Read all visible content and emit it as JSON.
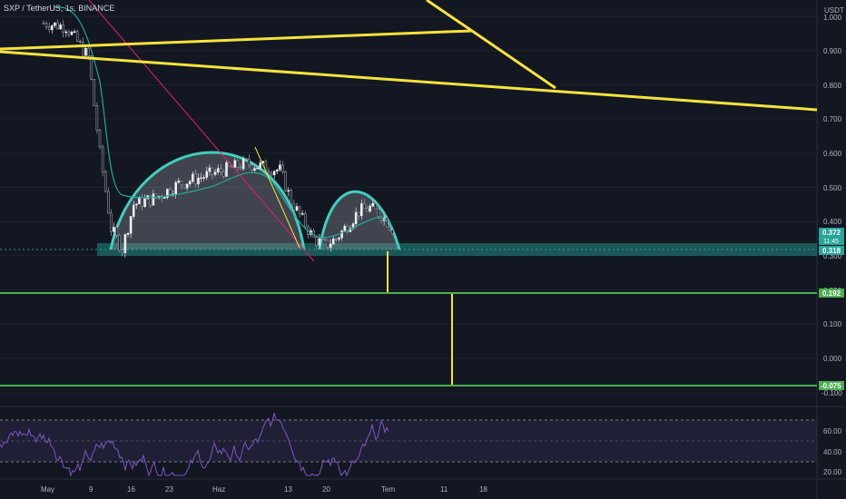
{
  "header": {
    "symbol_title": "SXP / TetherUS, 1s, BINANCE",
    "currency": "USDT"
  },
  "price_axis": {
    "ticks": [
      "1.000",
      "0.900",
      "0.800",
      "0.700",
      "0.600",
      "0.500",
      "0.400",
      "0.300",
      "0.200",
      "0.100",
      "0.000",
      "-0.100"
    ]
  },
  "price_labels": {
    "last_price": "0.372",
    "countdown": "11:45",
    "support": "0.318",
    "target_1": "0.192",
    "target_2": "-0.075"
  },
  "rsi_axis": {
    "ticks": [
      "60.00",
      "40.00",
      "20.00"
    ]
  },
  "time_axis": {
    "labels": [
      "May",
      "9",
      "16",
      "23",
      "Haz",
      "13",
      "20",
      "Tem",
      "11",
      "18"
    ]
  },
  "colors": {
    "background": "#131722",
    "candle_up": "#f0f3fa",
    "candle_down": "#b2b5be",
    "ma_line": "#26a69a",
    "trend_line": "#f5e33b",
    "cup_outline": "#3fcfbd",
    "downtrend_line": "#e91e63",
    "target_line": "#4caf50",
    "rsi_line": "#7e57c2",
    "support_zone": "#26a69a"
  },
  "chart_data": {
    "type": "candlestick",
    "title": "SXP / TetherUS, 1s, BINANCE",
    "x_labels": [
      "May",
      "9",
      "16",
      "23",
      "Haz",
      "13",
      "20",
      "Tem",
      "11",
      "18"
    ],
    "ylabel": "USDT",
    "ylim": [
      -0.1,
      1.0
    ],
    "series": [
      {
        "name": "SXP/USDT",
        "x_day": [
          0,
          4,
          8,
          10,
          12,
          14,
          16,
          20,
          24,
          30,
          36,
          42,
          44,
          48,
          50,
          52,
          56,
          58,
          60,
          62
        ],
        "values": [
          0.98,
          0.97,
          0.88,
          0.6,
          0.38,
          0.32,
          0.45,
          0.47,
          0.51,
          0.54,
          0.57,
          0.55,
          0.46,
          0.35,
          0.33,
          0.35,
          0.43,
          0.44,
          0.42,
          0.38
        ]
      }
    ],
    "horizontal_levels": [
      0.318,
      0.192,
      -0.075
    ],
    "rsi": {
      "ylim": [
        15,
        75
      ],
      "levels": [
        30,
        70
      ]
    }
  }
}
